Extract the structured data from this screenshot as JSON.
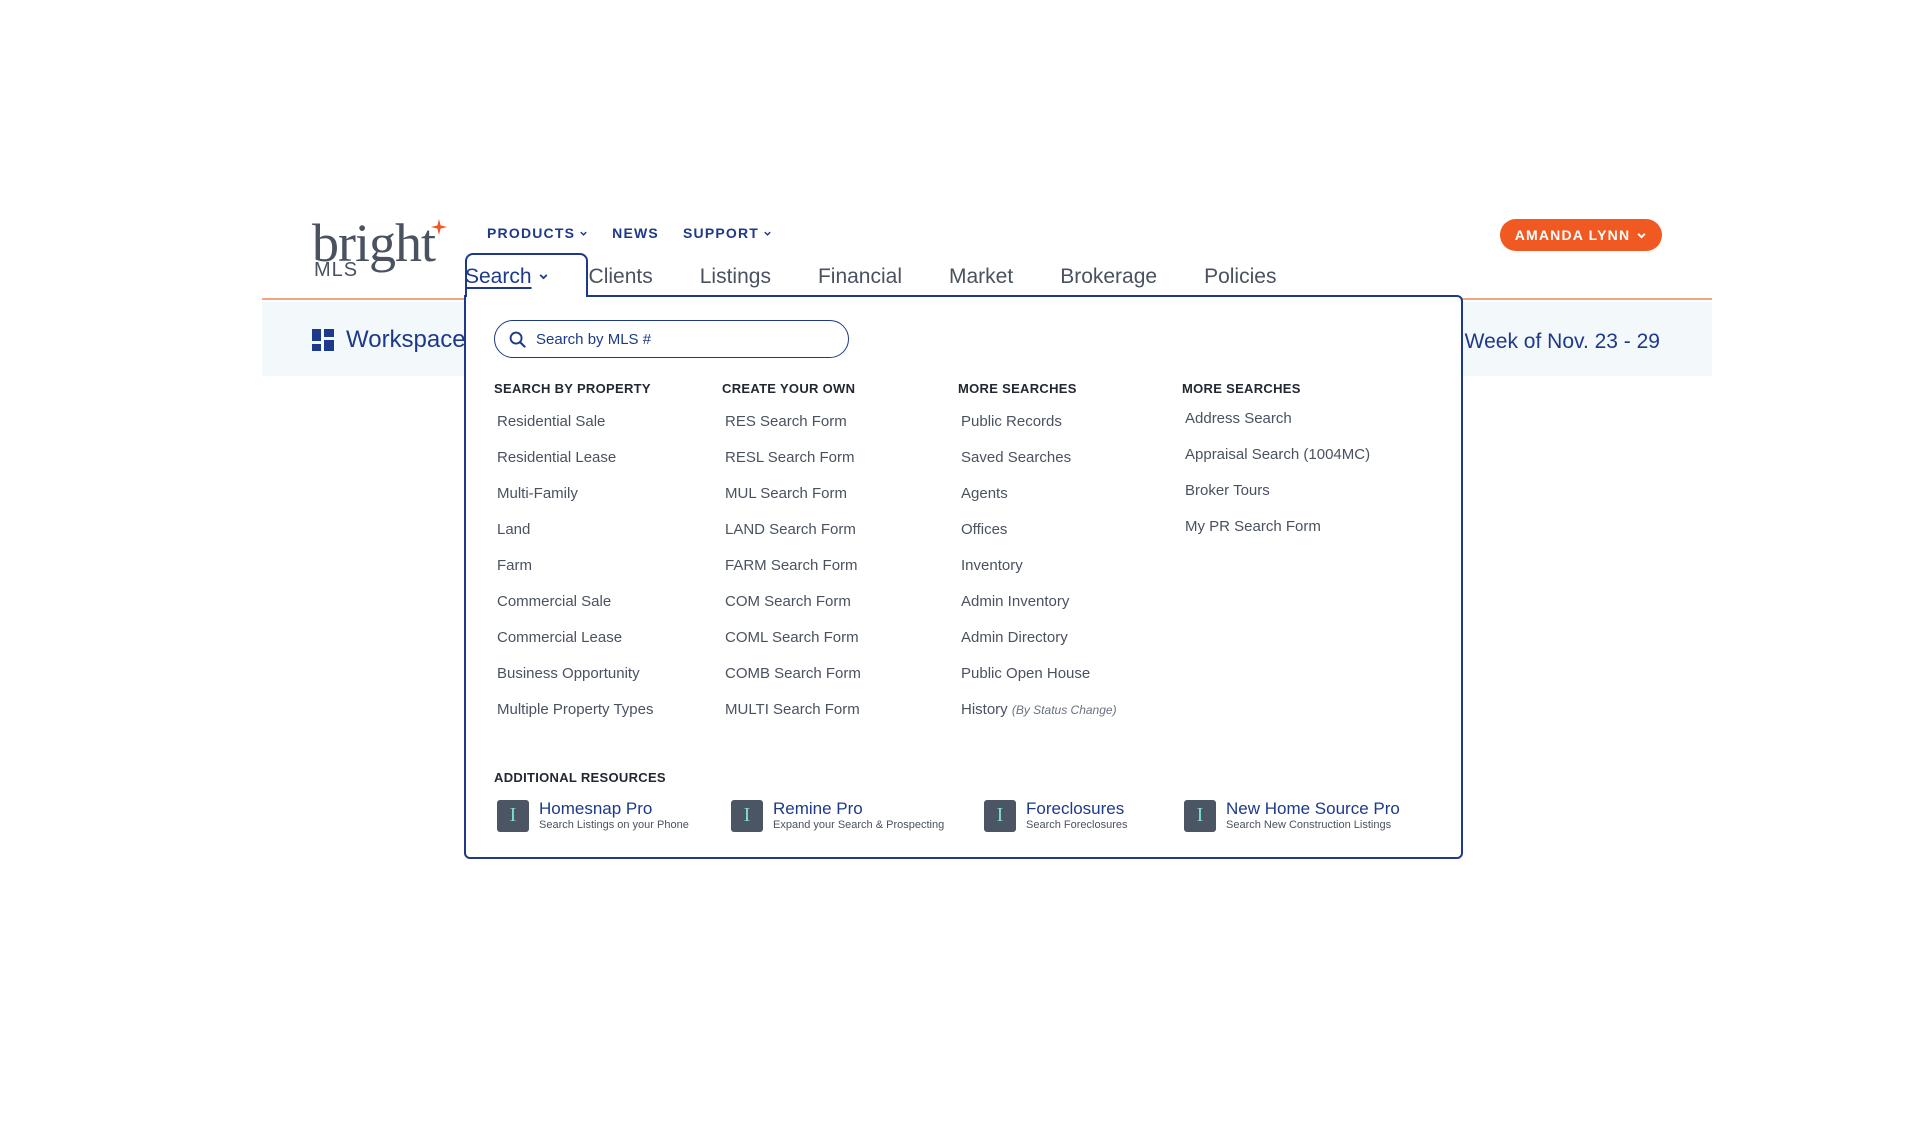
{
  "logo": {
    "wordmark": "bright",
    "sub": "MLS"
  },
  "topnav": [
    {
      "label": "PRODUCTS",
      "dropdown": true
    },
    {
      "label": "NEWS",
      "dropdown": false
    },
    {
      "label": "SUPPORT",
      "dropdown": true
    }
  ],
  "user": {
    "name": "AMANDA LYNN"
  },
  "mainnav": [
    "Search",
    "Clients",
    "Listings",
    "Financial",
    "Market",
    "Brokerage",
    "Policies"
  ],
  "subbar": {
    "workspace": "Workspace",
    "week": "Week of Nov. 23 - 29"
  },
  "search": {
    "placeholder": "Search by MLS #"
  },
  "columns": [
    {
      "heading": "SEARCH BY PROPERTY",
      "items": [
        "Residential Sale",
        "Residential Lease",
        "Multi-Family",
        "Land",
        "Farm",
        "Commercial Sale",
        "Commercial Lease",
        "Business Opportunity",
        "Multiple Property Types"
      ]
    },
    {
      "heading": "CREATE YOUR OWN",
      "items": [
        "RES Search Form",
        "RESL Search Form",
        "MUL Search Form",
        "LAND Search Form",
        "FARM Search Form",
        "COM Search Form",
        "COML Search Form",
        "COMB Search Form",
        "MULTI Search Form"
      ]
    },
    {
      "heading": "MORE SEARCHES",
      "items": [
        "Public Records",
        "Saved Searches",
        "Agents",
        "Offices",
        "Inventory",
        "Admin Inventory",
        "Admin Directory",
        "Public Open House",
        "History"
      ],
      "last_note": "(By Status Change)"
    },
    {
      "heading": "MORE SEARCHES",
      "items": [
        "Address Search",
        "Appraisal Search (1004MC)",
        "Broker Tours",
        "My PR Search Form"
      ]
    }
  ],
  "resources": {
    "heading": "ADDITIONAL RESOURCES",
    "icon_glyph": "I",
    "items": [
      {
        "title": "Homesnap Pro",
        "subtitle": "Search Listings on your Phone"
      },
      {
        "title": "Remine Pro",
        "subtitle": "Expand your Search & Prospecting"
      },
      {
        "title": "Foreclosures",
        "subtitle": "Search Foreclosures"
      },
      {
        "title": "New Home Source Pro",
        "subtitle": "Search New Construction Listings"
      }
    ]
  },
  "colors": {
    "brand_blue": "#1d3a8a",
    "accent_orange": "#f05a22",
    "resource_icon_bg": "#4b5563",
    "resource_icon_fg": "#7fe0c7"
  }
}
